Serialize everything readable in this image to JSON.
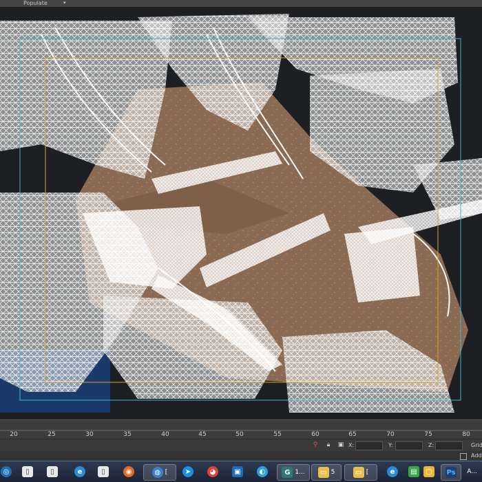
{
  "menubar": {
    "populate_label": "Populate",
    "dropdown_glyph": "▾"
  },
  "viewport": {
    "description_icon": "wireframe-scene",
    "colors": {
      "terrain": "#8a6a52",
      "wire": "#ffffff",
      "safe_frame_outer": "#3fb7c9",
      "safe_frame_inner": "#d4a62a"
    }
  },
  "timeline": {
    "ticks": [
      "20",
      "25",
      "30",
      "35",
      "40",
      "45",
      "50",
      "55",
      "60",
      "65",
      "70",
      "75",
      "80"
    ]
  },
  "statusbar": {
    "x_label": "X:",
    "y_label": "Y:",
    "z_label": "Z:",
    "grid_label": "Grid",
    "icons": [
      "pin-icon",
      "lock-icon",
      "transform-mode-icon"
    ]
  },
  "statusbar2": {
    "add_label": "Add"
  },
  "taskbar": {
    "items": [
      {
        "name": "start-button",
        "icon": "start-orb-icon",
        "label": "",
        "color": "#1f6fb8"
      },
      {
        "name": "file-explorer",
        "icon": "document-icon",
        "label": "",
        "color": "#e8e8e8"
      },
      {
        "name": "document",
        "icon": "document-icon",
        "label": "[",
        "color": "#e8e8e8"
      },
      {
        "name": "document-2",
        "icon": "document-icon",
        "label": "",
        "color": "#e8e8e8"
      },
      {
        "name": "internet-explorer",
        "icon": "ie-icon",
        "label": "",
        "color": "#2a8ad8"
      },
      {
        "name": "document-3",
        "icon": "document-icon",
        "label": "",
        "color": "#e8e8e8"
      },
      {
        "name": "firefox",
        "icon": "firefox-icon",
        "label": "",
        "color": "#e86a1e"
      },
      {
        "name": "app-globe",
        "icon": "globe-icon",
        "label": "[",
        "color": "#3b7fd1"
      },
      {
        "name": "app-blue",
        "icon": "swift-icon",
        "label": "",
        "color": "#1d8fe0"
      },
      {
        "name": "chrome",
        "icon": "chrome-icon",
        "label": "",
        "color": "#dc4437"
      },
      {
        "name": "app-window",
        "icon": "window-icon",
        "label": "",
        "color": "#1a6db8"
      },
      {
        "name": "app-skype",
        "icon": "circle-app-icon",
        "label": "",
        "color": "#2aa3dc"
      },
      {
        "name": "3dsmax",
        "icon": "max-icon",
        "label": "1...",
        "color": "#2b7a78"
      },
      {
        "name": "folder-5",
        "icon": "folder-icon",
        "label": "5",
        "color": "#e8c14a"
      },
      {
        "name": "folder",
        "icon": "folder-icon",
        "label": "[",
        "color": "#e8c14a"
      },
      {
        "name": "ie-2",
        "icon": "ie-icon",
        "label": "",
        "color": "#2a8ad8"
      },
      {
        "name": "app-green",
        "icon": "app-icon",
        "label": "",
        "color": "#3aa645"
      },
      {
        "name": "app-frame",
        "icon": "frame-icon",
        "label": "",
        "color": "#e8b83a"
      },
      {
        "name": "photoshop",
        "icon": "photoshop-icon",
        "label": "Ps",
        "color": "#1e3f6e"
      },
      {
        "name": "app-a",
        "icon": "app-icon",
        "label": "A...",
        "color": "#2e6fb0"
      }
    ]
  }
}
